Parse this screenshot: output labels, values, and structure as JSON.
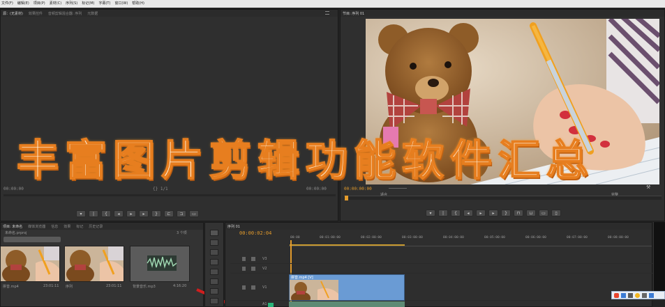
{
  "menu": {
    "items": [
      "文件(F)",
      "编辑(E)",
      "项目(P)",
      "素材(C)",
      "序列(S)",
      "标记(M)",
      "字幕(T)",
      "窗口(W)",
      "帮助(H)"
    ]
  },
  "source_panel": {
    "tabs": [
      "源：(无素材)",
      "效果控件",
      "音频剪辑混合器: 序列",
      "元数据"
    ],
    "timecode_left": "00:00:00",
    "timecode_right": "00:00:00",
    "zoom_marker": "{} 1/1"
  },
  "program_panel": {
    "tab": "节目: 序列 01",
    "timecode": "00:00:00:00",
    "fit_label": "适合",
    "quality_label": "完整",
    "wrench": "⚒"
  },
  "project_panel": {
    "tabs": [
      "项目: 未命名",
      "媒体浏览器",
      "信息",
      "效果",
      "标记",
      "历史记录"
    ],
    "project_file": "未命名.prproj",
    "item_count": "3 个项",
    "clips": [
      {
        "name": "拼音.mp4",
        "duration": "23:01:11"
      },
      {
        "name": "序列",
        "duration": "23:01:11"
      },
      {
        "name": "背景音乐.mp3",
        "duration": "4:16:20"
      }
    ]
  },
  "timeline": {
    "tab": "序列 01",
    "timecode": "00:00:02:04",
    "ruler": [
      "00:00",
      "00:01:00:00",
      "00:02:00:00",
      "00:03:00:00",
      "00:04:00:00",
      "00:05:00:00",
      "00:06:00:00",
      "00:07:00:00",
      "00:08:00:00"
    ],
    "tracks": [
      "V3",
      "V2",
      "V1",
      "A1"
    ],
    "clip_label": "拼音.mp4 [V]"
  },
  "overlay": {
    "title": "丰富图片剪辑功能软件汇总"
  },
  "colors": {
    "accent_orange": "#e39b2c",
    "timeline_clip": "#6a9bd4",
    "title_stroke": "#e77e1f"
  }
}
